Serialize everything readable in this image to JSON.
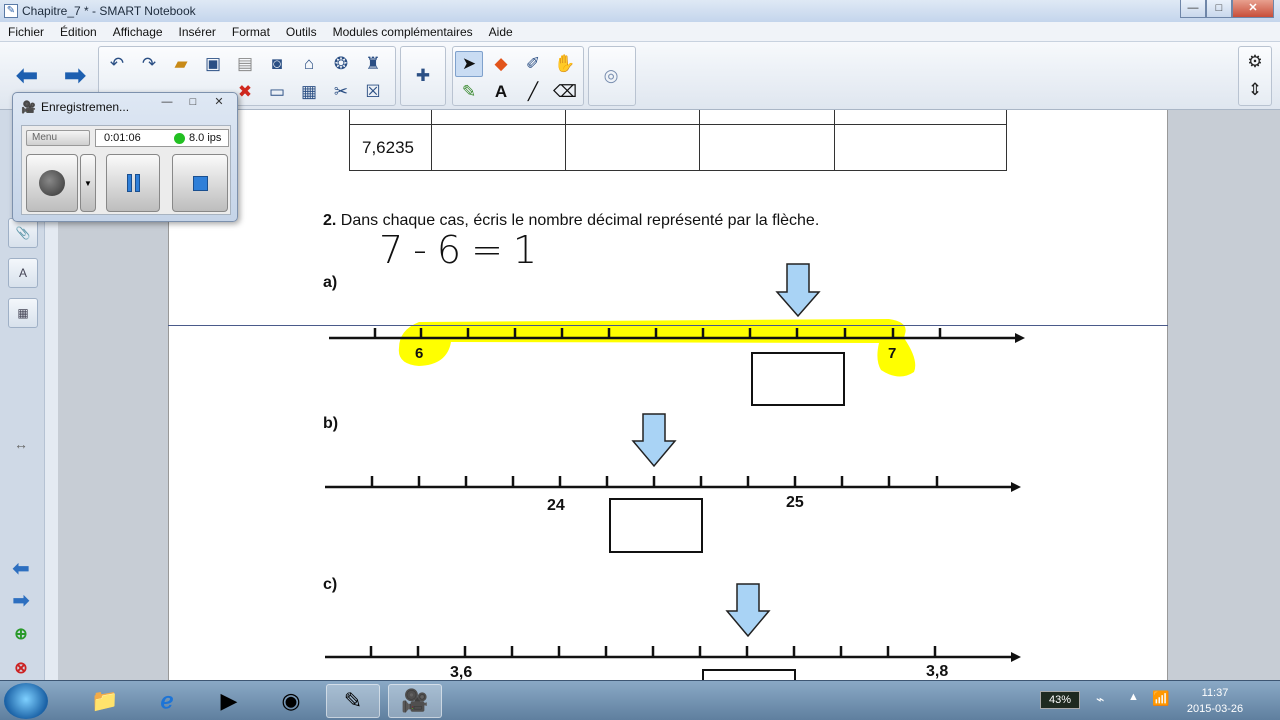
{
  "window": {
    "title": "Chapitre_7 * - SMART Notebook",
    "minimize": "—",
    "maximize": "□",
    "close": "✕"
  },
  "menu": [
    "Fichier",
    "Édition",
    "Affichage",
    "Insérer",
    "Format",
    "Outils",
    "Modules complémentaires",
    "Aide"
  ],
  "recorder": {
    "title": "Enregistremen...",
    "menu_label": "Menu",
    "elapsed": "0:01:06",
    "fps": "8.0 ips",
    "status_color": "#22c022"
  },
  "page": {
    "table_value": "7,6235",
    "question_number": "2.",
    "question_text": "Dans chaque cas, écris le nombre décimal représenté par la flèche.",
    "handwriting": "7-6=1",
    "parts": [
      {
        "label": "a)",
        "left_value": "6",
        "right_value": "7"
      },
      {
        "label": "b)",
        "left_value": "24",
        "right_value": "25"
      },
      {
        "label": "c)",
        "left_value": "3,6",
        "right_value": "3,8"
      }
    ],
    "highlight_color": "#ffff00",
    "arrow_fill": "#a9d3f5"
  },
  "taskbar": {
    "battery": "43%",
    "time": "11:37",
    "date": "2015-03-26"
  }
}
